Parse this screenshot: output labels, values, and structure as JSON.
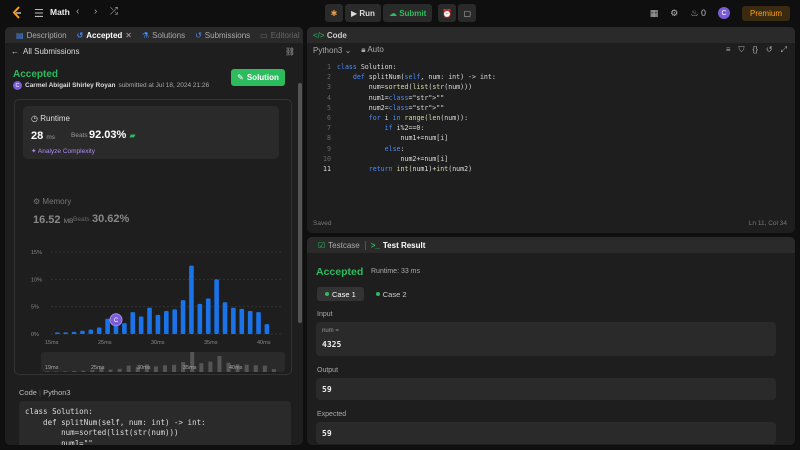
{
  "topbar": {
    "title": "Math",
    "run_label": "Run",
    "submit_label": "Submit",
    "streak": "0",
    "avatar": "C",
    "premium_label": "Premium"
  },
  "left_tabs": [
    {
      "label": "Description"
    },
    {
      "label": "Accepted"
    },
    {
      "label": "Solutions"
    },
    {
      "label": "Submissions"
    },
    {
      "label": "Editorial"
    }
  ],
  "submission": {
    "back_label": "All Submissions",
    "status": "Accepted",
    "author_initial": "C",
    "author": "Carmel Abigail Shirley Royan",
    "submitted_text": "submitted at Jul 18, 2024 21:26",
    "solution_label": "Solution",
    "runtime_label": "Runtime",
    "runtime_value": "28",
    "runtime_unit": "ms",
    "beats_label": "Beats",
    "runtime_pct": "92.03%",
    "analyze_label": "Analyze Complexity",
    "memory_label": "Memory",
    "memory_value": "16.52",
    "memory_unit": "MB",
    "memory_pct": "30.62%",
    "code_label": "Code",
    "code_lang": "Python3",
    "code_preview": "class Solution:\n    def splitNum(self, num: int) -> int:\n        num=sorted(list(str(num)))\n        num1=\"\"\n        num2=\"\"\n        for i in range(len(num)):"
  },
  "chart_data": {
    "type": "bar",
    "y_ticks": [
      "15%",
      "10%",
      "5%",
      "0%"
    ],
    "x_ticks": [
      "15ms",
      "25ms",
      "30ms",
      "35ms",
      "40ms"
    ],
    "ylim": [
      0,
      15
    ],
    "values": [
      0.3,
      0.3,
      0.4,
      0.6,
      0.8,
      1.2,
      2.8,
      1.5,
      2.0,
      4.0,
      3.2,
      4.8,
      3.5,
      4.2,
      4.5,
      6.2,
      12.5,
      5.5,
      6.5,
      10.0,
      5.8,
      4.8,
      4.6,
      4.2,
      4.0,
      1.8
    ],
    "marker_index": 7,
    "marker_label": "C",
    "brush_x_ticks": [
      "19ms",
      "25ms",
      "30ms",
      "35ms",
      "40ms"
    ]
  },
  "editor": {
    "panel_title": "Code",
    "language": "Python3",
    "mode": "Auto",
    "lines": [
      "class Solution:",
      "    def splitNum(self, num: int) -> int:",
      "        num=sorted(list(str(num)))",
      "        num1=\"\"",
      "        num2=\"\"",
      "        for i in range(len(num)):",
      "            if i%2==0:",
      "                num1+=num[i]",
      "            else:",
      "                num2+=num[i]",
      "        return int(num1)+int(num2)"
    ],
    "saved_label": "Saved",
    "cursor_pos": "Ln 11, Col 34"
  },
  "result": {
    "testcase_tab": "Testcase",
    "result_tab": "Test Result",
    "status": "Accepted",
    "runtime_text": "Runtime: 33 ms",
    "case1": "Case 1",
    "case2": "Case 2",
    "input_label": "Input",
    "input_var": "num =",
    "input_value": "4325",
    "output_label": "Output",
    "output_value": "59",
    "expected_label": "Expected",
    "expected_value": "59"
  },
  "colors": {
    "accent_green": "#2cbb5d",
    "bar_blue": "#1a73e8",
    "brand_orange": "#ffa116"
  }
}
